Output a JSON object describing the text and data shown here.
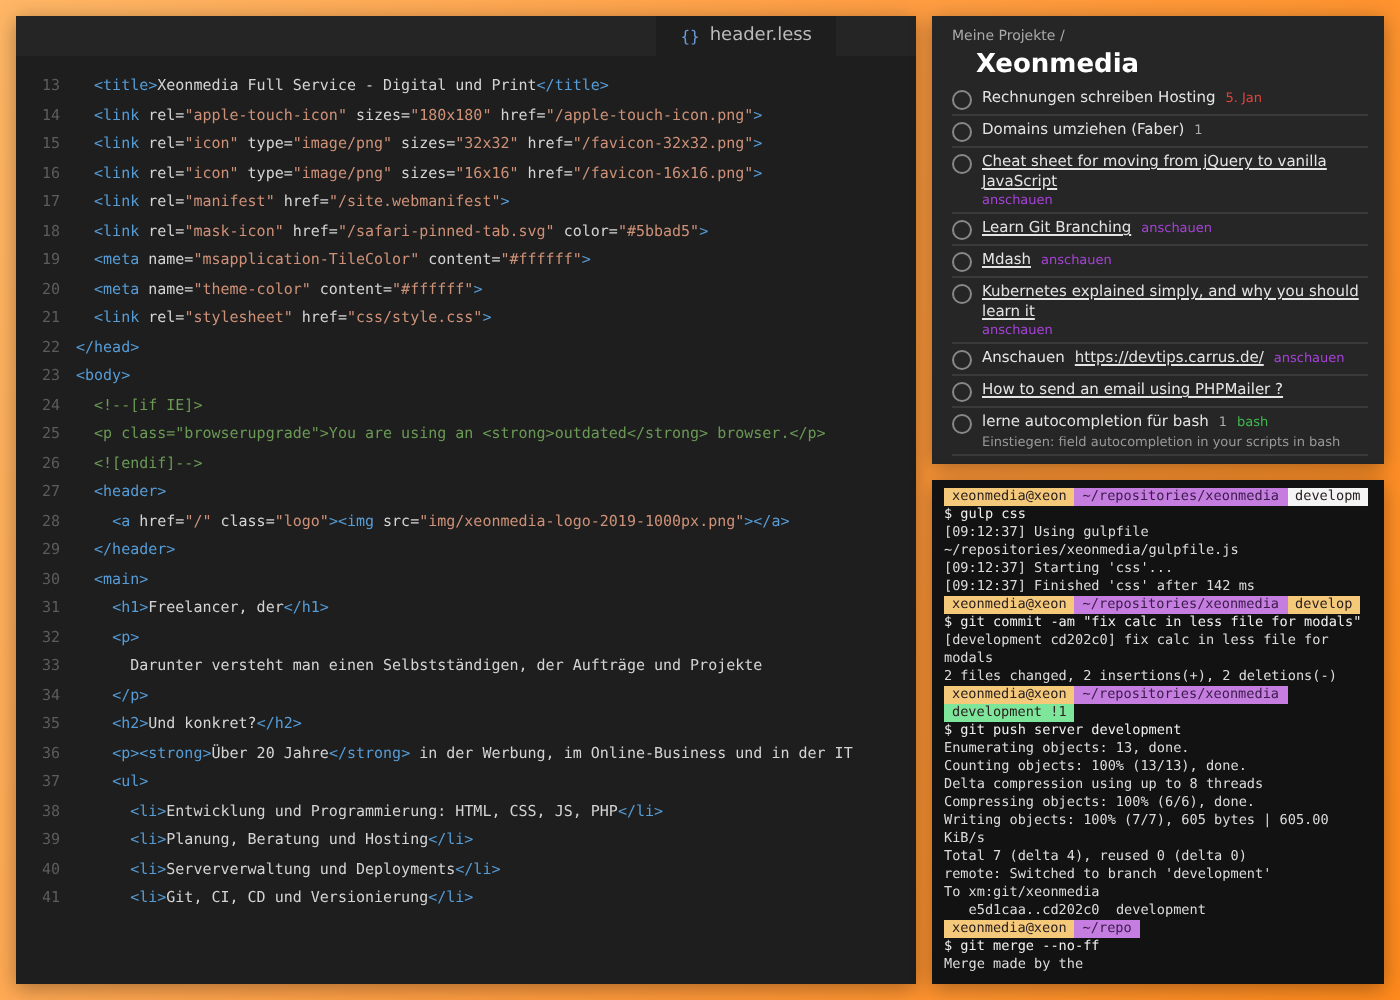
{
  "editor": {
    "tab": {
      "icon": "{}",
      "label": "header.less"
    },
    "lines": [
      {
        "number": "13",
        "kind": "code",
        "text": "  <title>Xeonmedia Full Service - Digital und Print</title>"
      },
      {
        "number": "14",
        "kind": "code",
        "text": "  <link rel=\"apple-touch-icon\" sizes=\"180x180\" href=\"/apple-touch-icon.png\">"
      },
      {
        "number": "15",
        "kind": "code",
        "text": "  <link rel=\"icon\" type=\"image/png\" sizes=\"32x32\" href=\"/favicon-32x32.png\">"
      },
      {
        "number": "16",
        "kind": "code",
        "text": "  <link rel=\"icon\" type=\"image/png\" sizes=\"16x16\" href=\"/favicon-16x16.png\">"
      },
      {
        "number": "17",
        "kind": "code",
        "text": "  <link rel=\"manifest\" href=\"/site.webmanifest\">"
      },
      {
        "number": "18",
        "kind": "code",
        "text": "  <link rel=\"mask-icon\" href=\"/safari-pinned-tab.svg\" color=\"#5bbad5\">"
      },
      {
        "number": "19",
        "kind": "code",
        "text": "  <meta name=\"msapplication-TileColor\" content=\"#ffffff\">"
      },
      {
        "number": "20",
        "kind": "code",
        "text": "  <meta name=\"theme-color\" content=\"#ffffff\">"
      },
      {
        "number": "21",
        "kind": "code",
        "text": "  <link rel=\"stylesheet\" href=\"css/style.css\">"
      },
      {
        "number": "22",
        "kind": "code",
        "text": "</head>"
      },
      {
        "number": "23",
        "kind": "code",
        "text": "<body>"
      },
      {
        "number": "24",
        "kind": "comment",
        "text": "  <!--[if IE]>"
      },
      {
        "number": "25",
        "kind": "comment",
        "text": "  <p class=\"browserupgrade\">You are using an <strong>outdated</strong> browser.</p>"
      },
      {
        "number": "26",
        "kind": "comment",
        "text": "  <![endif]-->"
      },
      {
        "number": "27",
        "kind": "code",
        "text": "  <header>"
      },
      {
        "number": "28",
        "kind": "code",
        "text": "    <a href=\"/\" class=\"logo\"><img src=\"img/xeonmedia-logo-2019-1000px.png\"></a>"
      },
      {
        "number": "29",
        "kind": "code",
        "text": "  </header>"
      },
      {
        "number": "30",
        "kind": "code",
        "text": "  <main>"
      },
      {
        "number": "31",
        "kind": "code",
        "text": "    <h1>Freelancer, der</h1>"
      },
      {
        "number": "32",
        "kind": "code",
        "text": "    <p>"
      },
      {
        "number": "33",
        "kind": "code",
        "text": "      Darunter versteht man einen Selbstständigen, der Aufträge und Projekte"
      },
      {
        "number": "34",
        "kind": "code",
        "text": "    </p>"
      },
      {
        "number": "35",
        "kind": "code",
        "text": "    <h2>Und konkret?</h2>"
      },
      {
        "number": "36",
        "kind": "code",
        "text": "    <p><strong>Über 20 Jahre</strong> in der Werbung, im Online-Business und in der IT"
      },
      {
        "number": "37",
        "kind": "code",
        "text": "    <ul>"
      },
      {
        "number": "38",
        "kind": "code",
        "text": "      <li>Entwicklung und Programmierung: HTML, CSS, JS, PHP</li>"
      },
      {
        "number": "39",
        "kind": "code",
        "text": "      <li>Planung, Beratung und Hosting</li>"
      },
      {
        "number": "40",
        "kind": "code",
        "text": "      <li>Serververwaltung und Deployments</li>"
      },
      {
        "number": "41",
        "kind": "code",
        "text": "      <li>Git, CI, CD und Versionierung</li>"
      }
    ]
  },
  "todo": {
    "breadcrumb": "Meine Projekte /",
    "title": "Xeonmedia",
    "items": [
      {
        "title": "Rechnungen schreiben Hosting",
        "checked": false,
        "link": false,
        "meta": [
          {
            "kind": "date",
            "text": "5. Jan",
            "color": "#e0443a"
          }
        ]
      },
      {
        "title": "Domains umziehen (Faber)",
        "checked": false,
        "link": false,
        "meta": [
          {
            "kind": "comments",
            "text": "1"
          }
        ]
      },
      {
        "title": "Cheat sheet for moving from jQuery to vanilla JavaScript",
        "checked": false,
        "link": true,
        "meta": [
          {
            "kind": "tag",
            "text": "anschauen",
            "color": "#a642d6"
          }
        ]
      },
      {
        "title": "Learn Git Branching",
        "checked": false,
        "link": true,
        "meta": [
          {
            "kind": "tag",
            "text": "anschauen",
            "color": "#a642d6"
          }
        ]
      },
      {
        "title": "Mdash",
        "checked": false,
        "link": true,
        "meta": [
          {
            "kind": "tag",
            "text": "anschauen",
            "color": "#a642d6"
          }
        ]
      },
      {
        "title": "Kubernetes explained simply, and why you should learn it",
        "checked": false,
        "link": true,
        "meta": [
          {
            "kind": "tag",
            "text": "anschauen",
            "color": "#a642d6"
          }
        ]
      },
      {
        "title": "Anschauen",
        "url": "https://devtips.carrus.de/",
        "checked": false,
        "link": false,
        "meta": [
          {
            "kind": "tag",
            "text": "anschauen",
            "color": "#a642d6"
          }
        ]
      },
      {
        "title": "How to send an email using PHPMailer ?",
        "checked": false,
        "link": true
      },
      {
        "title": "lerne autocompletion für bash",
        "checked": false,
        "link": false,
        "note": "Einstiegen: field autocompletion in your scripts in bash",
        "meta": [
          {
            "kind": "comments",
            "text": "1"
          },
          {
            "kind": "tag",
            "text": "bash",
            "color": "#3fb950"
          }
        ]
      }
    ]
  },
  "terminal": {
    "lines": [
      {
        "kind": "prompt",
        "user": "xeonmedia@xeon",
        "path": "~/repositories/xeonmedia",
        "branch": "developm",
        "color": "#f4f4f4"
      },
      {
        "kind": "cmd",
        "text": "$ gulp css"
      },
      {
        "kind": "out",
        "text": "[09:12:37] Using gulpfile ~/repositories/xeonmedia/gulpfile.js"
      },
      {
        "kind": "out",
        "text": "[09:12:37] Starting 'css'..."
      },
      {
        "kind": "out",
        "text": "[09:12:37] Finished 'css' after 142 ms"
      },
      {
        "kind": "prompt",
        "user": "xeonmedia@xeon",
        "path": "~/repositories/xeonmedia",
        "branch": "develop",
        "color": "#f5c97a"
      },
      {
        "kind": "cmd",
        "text": "$ git commit -am \"fix calc in less file for modals\""
      },
      {
        "kind": "out",
        "text": "[development cd202c0] fix calc in less file for modals"
      },
      {
        "kind": "out",
        "text": "2 files changed, 2 insertions(+), 2 deletions(-)"
      },
      {
        "kind": "prompt",
        "user": "xeonmedia@xeon",
        "path": "~/repositories/xeonmedia",
        "branch": "development !1",
        "color": "#7ee69a"
      },
      {
        "kind": "cmd",
        "text": "$ git push server development"
      },
      {
        "kind": "out",
        "text": "Enumerating objects: 13, done."
      },
      {
        "kind": "out",
        "text": "Counting objects: 100% (13/13), done."
      },
      {
        "kind": "out",
        "text": "Delta compression using up to 8 threads"
      },
      {
        "kind": "out",
        "text": "Compressing objects: 100% (6/6), done."
      },
      {
        "kind": "out",
        "text": "Writing objects: 100% (7/7), 605 bytes | 605.00 KiB/s"
      },
      {
        "kind": "out",
        "text": "Total 7 (delta 4), reused 0 (delta 0)"
      },
      {
        "kind": "out",
        "text": "remote: Switched to branch 'development'"
      },
      {
        "kind": "out",
        "text": "To xm:git/xeonmedia"
      },
      {
        "kind": "out",
        "text": "   e5d1caa..cd202c0  development"
      },
      {
        "kind": "prompt",
        "user": "xeonmedia@xeon",
        "path": "~/repo"
      },
      {
        "kind": "cmd",
        "text": "$ git merge --no-ff"
      },
      {
        "kind": "out",
        "text": "Merge made by the"
      }
    ]
  }
}
